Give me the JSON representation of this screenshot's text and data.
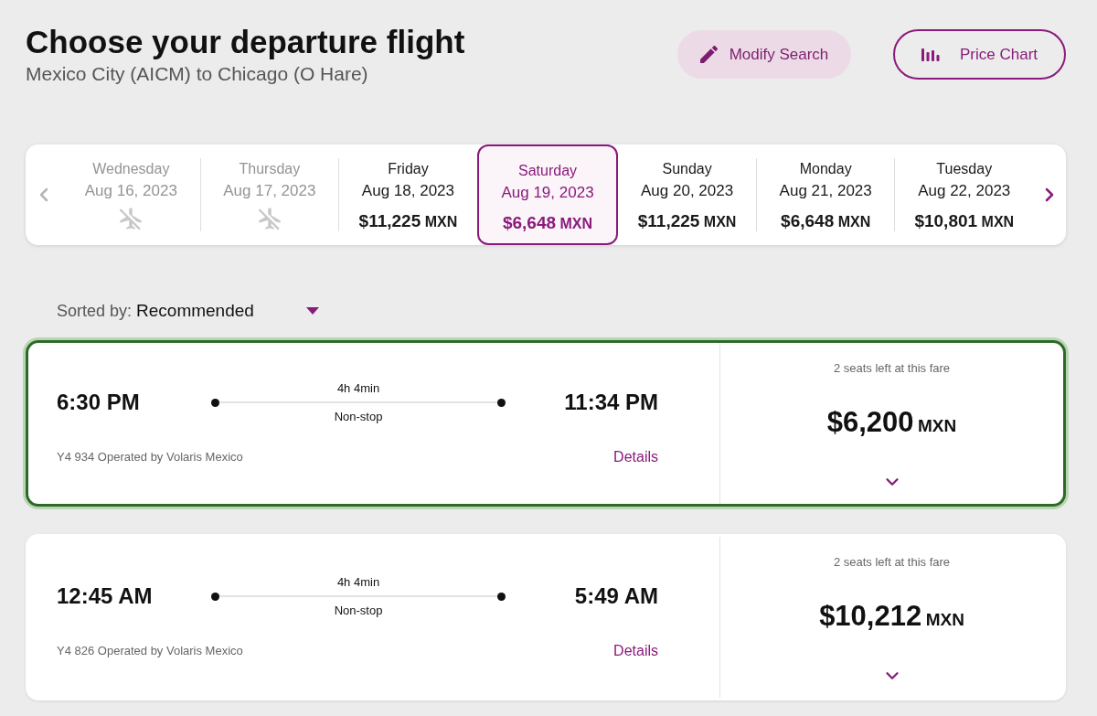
{
  "header": {
    "title": "Choose your departure flight",
    "subtitle": "Mexico City (AICM) to Chicago (O Hare)",
    "buttons": [
      {
        "label": "Modify Search",
        "kind": "tonal"
      },
      {
        "label": "Price Chart",
        "kind": "outlined"
      }
    ]
  },
  "date_strip": {
    "prev": {
      "disabled": true
    },
    "next": {
      "disabled": false
    },
    "days": [
      {
        "day": "Wednesday",
        "date": "Aug 16, 2023",
        "disabled": true,
        "selected": false
      },
      {
        "day": "Thursday",
        "date": "Aug 17, 2023",
        "disabled": true,
        "selected": false
      },
      {
        "day": "Friday",
        "date": "Aug 18, 2023",
        "price": "$11,225",
        "currency": "MXN",
        "disabled": false,
        "selected": false
      },
      {
        "day": "Saturday",
        "date": "Aug 19, 2023",
        "price": "$6,648",
        "currency": "MXN",
        "disabled": false,
        "selected": true
      },
      {
        "day": "Sunday",
        "date": "Aug 20, 2023",
        "price": "$11,225",
        "currency": "MXN",
        "disabled": false,
        "selected": false
      },
      {
        "day": "Monday",
        "date": "Aug 21, 2023",
        "price": "$6,648",
        "currency": "MXN",
        "disabled": false,
        "selected": false
      },
      {
        "day": "Tuesday",
        "date": "Aug 22, 2023",
        "price": "$10,801",
        "currency": "MXN",
        "disabled": false,
        "selected": false
      }
    ]
  },
  "sort": {
    "label": "Sorted by:",
    "value": "Recommended"
  },
  "flights": [
    {
      "selected": true,
      "departure": "6:30 PM",
      "duration": "4h 4min",
      "stops": "Non-stop",
      "arrival": "11:34 PM",
      "operator": "Y4 934 Operated by Volaris Mexico",
      "details": "Details",
      "availability": "2 seats left at this fare",
      "price": "$6,200",
      "currency": "MXN"
    },
    {
      "selected": false,
      "departure": "12:45 AM",
      "duration": "4h 4min",
      "stops": "Non-stop",
      "arrival": "5:49 AM",
      "operator": "Y4 826 Operated by Volaris Mexico",
      "details": "Details",
      "availability": "2 seats left at this fare",
      "price": "$10,212",
      "currency": "MXN"
    }
  ]
}
